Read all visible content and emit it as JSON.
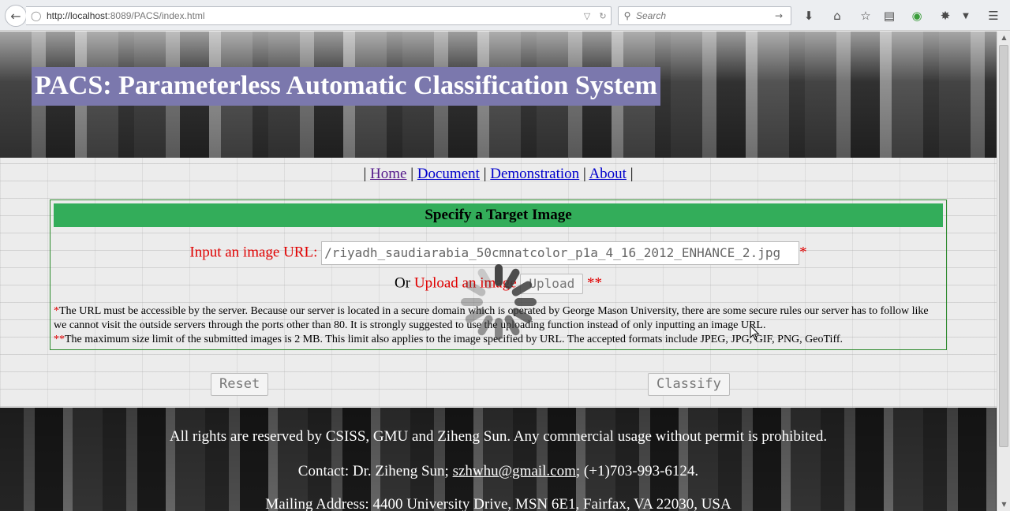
{
  "browser": {
    "url_host": "http://localhost",
    "url_path": ":8089/PACS/index.html",
    "search_placeholder": "Search"
  },
  "header": {
    "title": "PACS: Parameterless Automatic Classification System"
  },
  "nav": {
    "items": [
      "Home",
      "Document",
      "Demonstration",
      "About"
    ],
    "separator": "|"
  },
  "panel": {
    "heading": "Specify a Target Image",
    "url_label": "Input an image URL:",
    "url_value": "/riyadh_saudiarabia_50cmnatcolor_p1a_4_16_2012_ENHANCE_2.jpg",
    "url_required": "*",
    "or_text": "Or",
    "upload_label": "Upload an image",
    "upload_button": "Upload",
    "upload_required": "**",
    "note1_marker": "*",
    "note1": "The URL must be accessible by the server. Because our server is located in a secure domain which is operated by George Mason University, there are some secure rules our server has to follow like we cannot visit the outside servers through the ports other than 80. It is strongly suggested to use the uploading function instead of only inputting an image URL.",
    "note2_marker": "**",
    "note2": "The maximum size limit of the submitted images is 2 MB. This limit also applies to the image specified by URL. The accepted formats include JPEG, JPG, GIF, PNG, GeoTiff."
  },
  "buttons": {
    "reset": "Reset",
    "classify": "Classify"
  },
  "footer": {
    "rights": "All rights are reserved by CSISS, GMU and Ziheng Sun. Any commercial usage without permit is prohibited.",
    "contact_prefix": "Contact: Dr. Ziheng Sun; ",
    "contact_email": "szhwhu@gmail.com",
    "contact_suffix": "; (+1)703-993-6124.",
    "address": "Mailing Address: 4400 University Drive, MSN 6E1, Fairfax, VA 22030, USA"
  },
  "icons": {
    "back": "back-arrow-icon",
    "download": "download-icon",
    "home": "home-icon",
    "bookmark": "bookmark-star-icon",
    "reading_list": "reading-list-icon",
    "addon": "addon-icon",
    "menu": "hamburger-menu-icon",
    "spinner": "loading-spinner-icon"
  }
}
